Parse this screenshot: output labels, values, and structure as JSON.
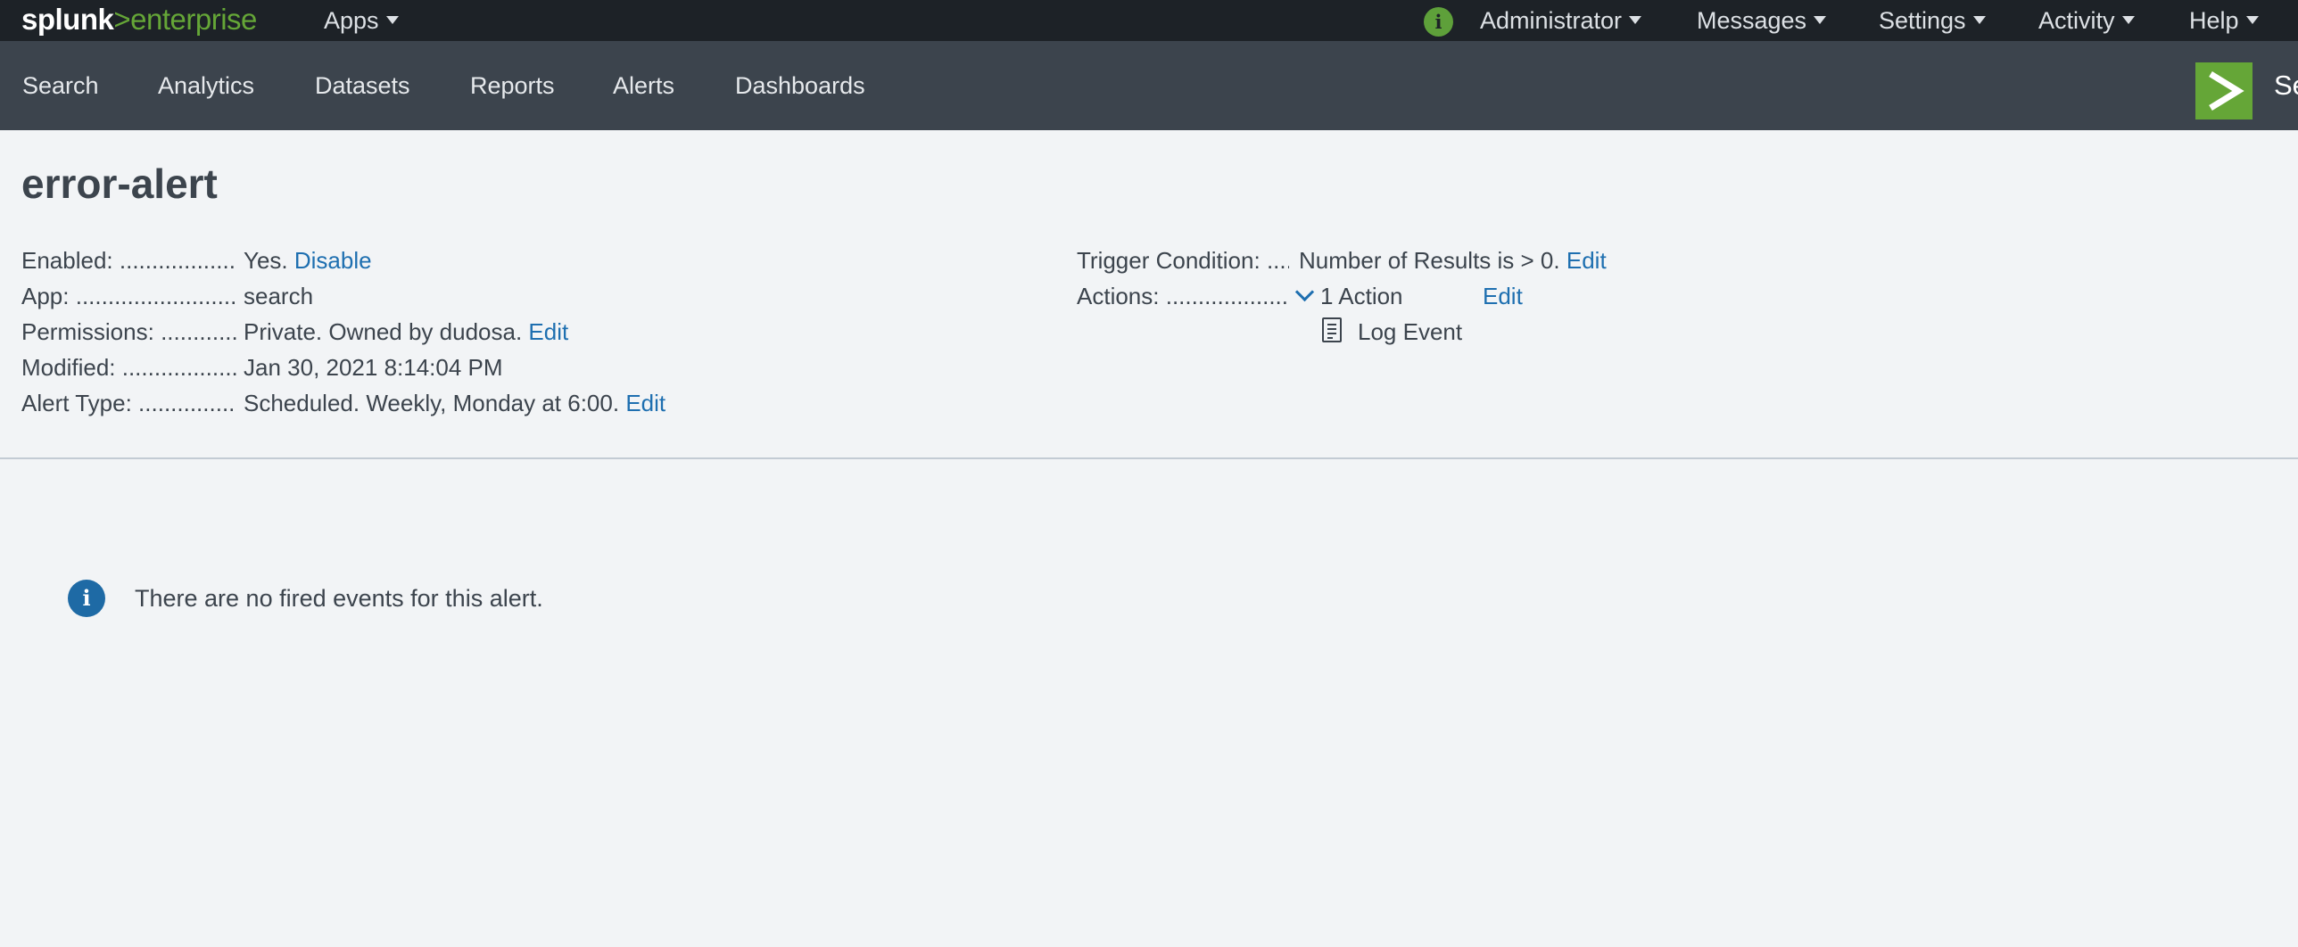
{
  "topbar": {
    "logo": {
      "part1": "splunk",
      "part2": ">",
      "part3": "enterprise"
    },
    "apps_label": "Apps",
    "info_icon": "info-icon",
    "administrator_label": "Administrator",
    "messages_label": "Messages",
    "settings_label": "Settings",
    "activity_label": "Activity",
    "help_label": "Help"
  },
  "appbar": {
    "tabs": [
      "Search",
      "Analytics",
      "Datasets",
      "Reports",
      "Alerts",
      "Dashboards"
    ],
    "app_title_partial": "Se"
  },
  "alert": {
    "title": "error-alert",
    "left": {
      "enabled": {
        "label": "Enabled:",
        "value": "Yes.",
        "link": "Disable"
      },
      "app": {
        "label": "App:",
        "value": "search"
      },
      "permissions": {
        "label": "Permissions:",
        "value": "Private. Owned by dudosa.",
        "link": "Edit"
      },
      "modified": {
        "label": "Modified:",
        "value": "Jan 30, 2021 8:14:04 PM"
      },
      "alert_type": {
        "label": "Alert Type:",
        "value": "Scheduled. Weekly, Monday at 6:00.",
        "link": "Edit"
      }
    },
    "right": {
      "trigger": {
        "label": "Trigger Condition:",
        "value": "Number of Results is > 0.",
        "link": "Edit"
      },
      "actions": {
        "label": "Actions:",
        "value": "1 Action",
        "link": "Edit"
      },
      "action_item": "Log Event"
    }
  },
  "message": {
    "text": "There are no fired events for this alert."
  },
  "colors": {
    "topbar": "#1d2227",
    "appbar": "#3c444d",
    "link": "#1e6fb0",
    "brand_green": "#65a637",
    "background": "#f2f4f6"
  }
}
